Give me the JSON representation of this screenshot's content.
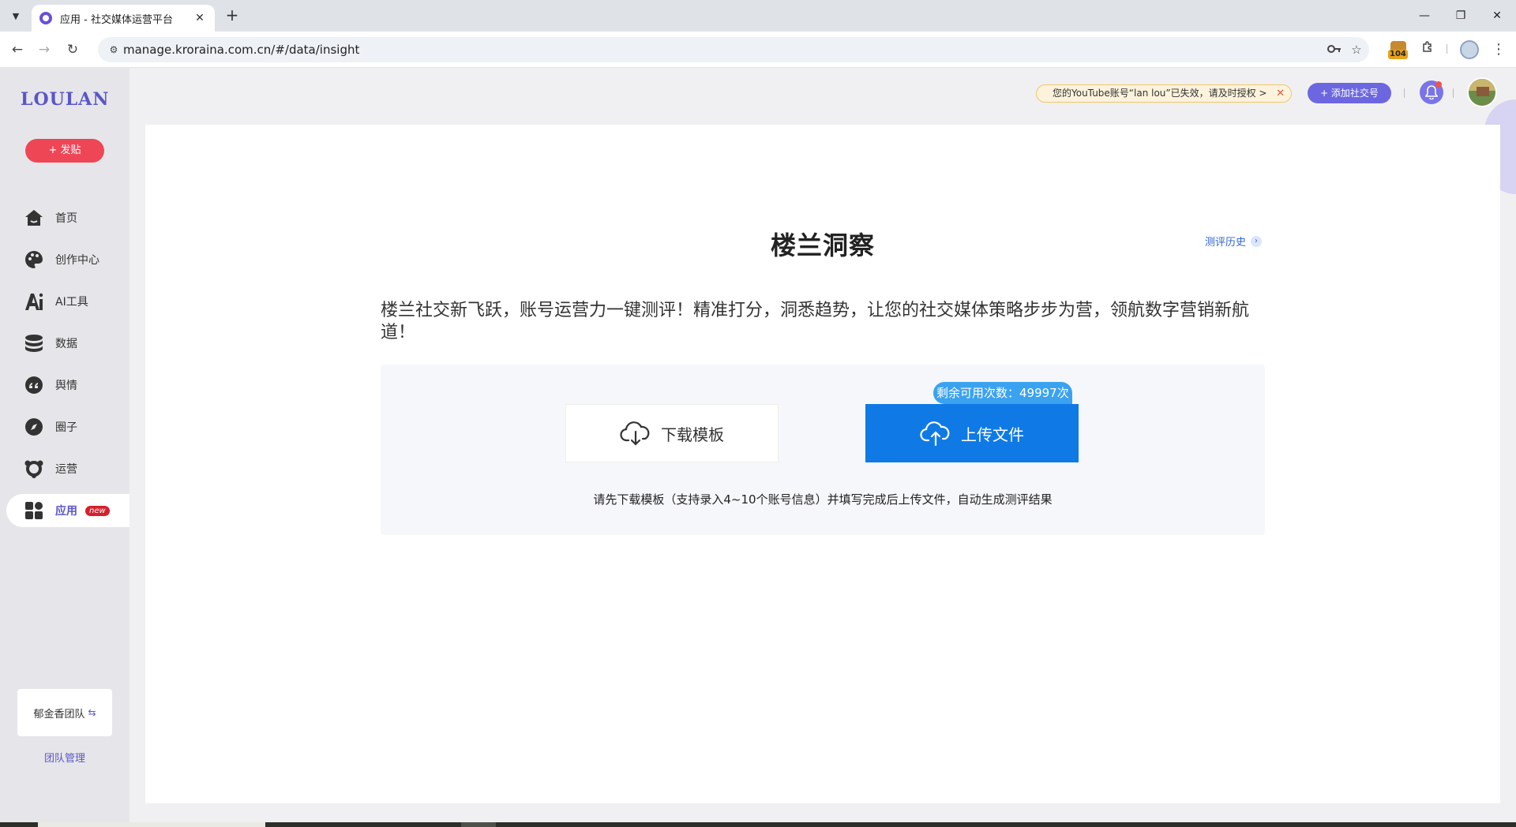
{
  "browser": {
    "tab_title": "应用 - 社交媒体运营平台",
    "tab_close": "✕",
    "new_tab": "+",
    "url": "manage.kroraina.com.cn/#/data/insight",
    "extension_count": "104",
    "window_controls": {
      "minimize": "—",
      "restore": "❐",
      "close": "✕"
    }
  },
  "sidebar": {
    "logo": "LOULAN",
    "post_button": "+ 发贴",
    "items": [
      {
        "label": "首页",
        "icon": "home-icon"
      },
      {
        "label": "创作中心",
        "icon": "palette-icon"
      },
      {
        "label": "AI工具",
        "icon": "ai-icon"
      },
      {
        "label": "数据",
        "icon": "database-icon"
      },
      {
        "label": "舆情",
        "icon": "quote-icon"
      },
      {
        "label": "圈子",
        "icon": "compass-icon"
      },
      {
        "label": "运营",
        "icon": "network-icon"
      },
      {
        "label": "应用",
        "icon": "apps-icon",
        "active": true,
        "badge": "new"
      }
    ],
    "team_name": "郁金香团队",
    "team_swap": "⇆",
    "team_manage": "团队管理"
  },
  "header": {
    "notice": "您的YouTube账号“lan lou”已失效，请及时授权 >",
    "notice_close": "✕",
    "add_social": "+ 添加社交号"
  },
  "main": {
    "title": "楼兰洞察",
    "history_link": "测评历史",
    "history_chevron": "›",
    "description": "楼兰社交新飞跃，账号运营力一键测评！精准打分，洞悉趋势，让您的社交媒体策略步步为营，领航数字营销新航道！",
    "download_button": "下载模板",
    "upload_button": "上传文件",
    "quota": "剩余可用次数：49997次",
    "hint": "请先下载模板（支持录入4~10个账号信息）并填写完成后上传文件，自动生成测评结果"
  },
  "colors": {
    "brand": "#5a56c9",
    "post_red": "#ef4656",
    "upload_blue": "#0f7ae5",
    "quota_blue": "#3ba2f0"
  }
}
